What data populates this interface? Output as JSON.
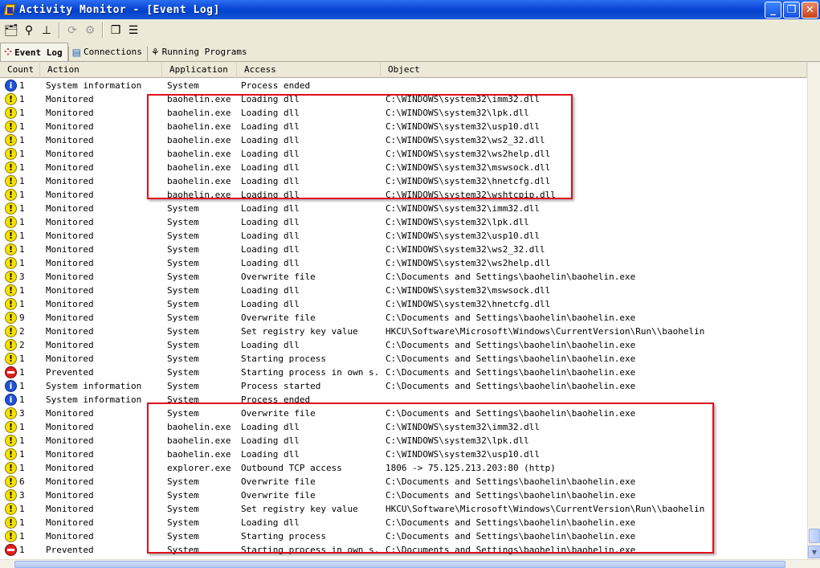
{
  "window": {
    "title": "Activity Monitor - [Event Log]",
    "icon": "activity-monitor-app-icon",
    "buttons": [
      "minimize",
      "maximize",
      "close"
    ]
  },
  "toolbar": {
    "icons": [
      "properties-icon",
      "find-icon",
      "filter-icon",
      "refresh-icon",
      "settings-icon",
      "cascade-icon",
      "tile-icon"
    ]
  },
  "tabs": [
    {
      "label": "Event Log",
      "icon": "event-log-icon",
      "active": true
    },
    {
      "label": "Connections",
      "icon": "connections-icon",
      "active": false
    },
    {
      "label": "Running Programs",
      "icon": "running-programs-icon",
      "active": false
    }
  ],
  "columns": [
    "Count",
    "Action",
    "Application",
    "Access",
    "Object"
  ],
  "rows": [
    {
      "type": "info",
      "count": "1",
      "action": "System information",
      "app": "System",
      "access": "Process ended",
      "object": ""
    },
    {
      "type": "warn",
      "count": "1",
      "action": "Monitored",
      "app": "baohelin.exe",
      "access": "Loading dll",
      "object": "C:\\WINDOWS\\system32\\imm32.dll"
    },
    {
      "type": "warn",
      "count": "1",
      "action": "Monitored",
      "app": "baohelin.exe",
      "access": "Loading dll",
      "object": "C:\\WINDOWS\\system32\\lpk.dll"
    },
    {
      "type": "warn",
      "count": "1",
      "action": "Monitored",
      "app": "baohelin.exe",
      "access": "Loading dll",
      "object": "C:\\WINDOWS\\system32\\usp10.dll"
    },
    {
      "type": "warn",
      "count": "1",
      "action": "Monitored",
      "app": "baohelin.exe",
      "access": "Loading dll",
      "object": "C:\\WINDOWS\\system32\\ws2_32.dll"
    },
    {
      "type": "warn",
      "count": "1",
      "action": "Monitored",
      "app": "baohelin.exe",
      "access": "Loading dll",
      "object": "C:\\WINDOWS\\system32\\ws2help.dll"
    },
    {
      "type": "warn",
      "count": "1",
      "action": "Monitored",
      "app": "baohelin.exe",
      "access": "Loading dll",
      "object": "C:\\WINDOWS\\system32\\mswsock.dll"
    },
    {
      "type": "warn",
      "count": "1",
      "action": "Monitored",
      "app": "baohelin.exe",
      "access": "Loading dll",
      "object": "C:\\WINDOWS\\system32\\hnetcfg.dll"
    },
    {
      "type": "warn",
      "count": "1",
      "action": "Monitored",
      "app": "baohelin.exe",
      "access": "Loading dll",
      "object": "C:\\WINDOWS\\system32\\wshtcpip.dll"
    },
    {
      "type": "warn",
      "count": "1",
      "action": "Monitored",
      "app": "System",
      "access": "Loading dll",
      "object": "C:\\WINDOWS\\system32\\imm32.dll"
    },
    {
      "type": "warn",
      "count": "1",
      "action": "Monitored",
      "app": "System",
      "access": "Loading dll",
      "object": "C:\\WINDOWS\\system32\\lpk.dll"
    },
    {
      "type": "warn",
      "count": "1",
      "action": "Monitored",
      "app": "System",
      "access": "Loading dll",
      "object": "C:\\WINDOWS\\system32\\usp10.dll"
    },
    {
      "type": "warn",
      "count": "1",
      "action": "Monitored",
      "app": "System",
      "access": "Loading dll",
      "object": "C:\\WINDOWS\\system32\\ws2_32.dll"
    },
    {
      "type": "warn",
      "count": "1",
      "action": "Monitored",
      "app": "System",
      "access": "Loading dll",
      "object": "C:\\WINDOWS\\system32\\ws2help.dll"
    },
    {
      "type": "warn",
      "count": "3",
      "action": "Monitored",
      "app": "System",
      "access": "Overwrite file",
      "object": "C:\\Documents and Settings\\baohelin\\baohelin.exe"
    },
    {
      "type": "warn",
      "count": "1",
      "action": "Monitored",
      "app": "System",
      "access": "Loading dll",
      "object": "C:\\WINDOWS\\system32\\mswsock.dll"
    },
    {
      "type": "warn",
      "count": "1",
      "action": "Monitored",
      "app": "System",
      "access": "Loading dll",
      "object": "C:\\WINDOWS\\system32\\hnetcfg.dll"
    },
    {
      "type": "warn",
      "count": "9",
      "action": "Monitored",
      "app": "System",
      "access": "Overwrite file",
      "object": "C:\\Documents and Settings\\baohelin\\baohelin.exe"
    },
    {
      "type": "warn",
      "count": "2",
      "action": "Monitored",
      "app": "System",
      "access": "Set registry key value",
      "object": "HKCU\\Software\\Microsoft\\Windows\\CurrentVersion\\Run\\\\baohelin"
    },
    {
      "type": "warn",
      "count": "2",
      "action": "Monitored",
      "app": "System",
      "access": "Loading dll",
      "object": "C:\\Documents and Settings\\baohelin\\baohelin.exe"
    },
    {
      "type": "warn",
      "count": "1",
      "action": "Monitored",
      "app": "System",
      "access": "Starting process",
      "object": "C:\\Documents and Settings\\baohelin\\baohelin.exe"
    },
    {
      "type": "stop",
      "count": "1",
      "action": "Prevented",
      "app": "System",
      "access": "Starting process in own s...",
      "object": "C:\\Documents and Settings\\baohelin\\baohelin.exe"
    },
    {
      "type": "info",
      "count": "1",
      "action": "System information",
      "app": "System",
      "access": "Process started",
      "object": "C:\\Documents and Settings\\baohelin\\baohelin.exe"
    },
    {
      "type": "info",
      "count": "1",
      "action": "System information",
      "app": "System",
      "access": "Process ended",
      "object": ""
    },
    {
      "type": "warn",
      "count": "3",
      "action": "Monitored",
      "app": "System",
      "access": "Overwrite file",
      "object": "C:\\Documents and Settings\\baohelin\\baohelin.exe"
    },
    {
      "type": "warn",
      "count": "1",
      "action": "Monitored",
      "app": "baohelin.exe",
      "access": "Loading dll",
      "object": "C:\\WINDOWS\\system32\\imm32.dll"
    },
    {
      "type": "warn",
      "count": "1",
      "action": "Monitored",
      "app": "baohelin.exe",
      "access": "Loading dll",
      "object": "C:\\WINDOWS\\system32\\lpk.dll"
    },
    {
      "type": "warn",
      "count": "1",
      "action": "Monitored",
      "app": "baohelin.exe",
      "access": "Loading dll",
      "object": "C:\\WINDOWS\\system32\\usp10.dll"
    },
    {
      "type": "warn",
      "count": "1",
      "action": "Monitored",
      "app": "explorer.exe",
      "access": "Outbound TCP access",
      "object": "1806 -> 75.125.213.203:80 (http)"
    },
    {
      "type": "warn",
      "count": "6",
      "action": "Monitored",
      "app": "System",
      "access": "Overwrite file",
      "object": "C:\\Documents and Settings\\baohelin\\baohelin.exe"
    },
    {
      "type": "warn",
      "count": "3",
      "action": "Monitored",
      "app": "System",
      "access": "Overwrite file",
      "object": "C:\\Documents and Settings\\baohelin\\baohelin.exe"
    },
    {
      "type": "warn",
      "count": "1",
      "action": "Monitored",
      "app": "System",
      "access": "Set registry key value",
      "object": "HKCU\\Software\\Microsoft\\Windows\\CurrentVersion\\Run\\\\baohelin"
    },
    {
      "type": "warn",
      "count": "1",
      "action": "Monitored",
      "app": "System",
      "access": "Loading dll",
      "object": "C:\\Documents and Settings\\baohelin\\baohelin.exe"
    },
    {
      "type": "warn",
      "count": "1",
      "action": "Monitored",
      "app": "System",
      "access": "Starting process",
      "object": "C:\\Documents and Settings\\baohelin\\baohelin.exe"
    },
    {
      "type": "stop",
      "count": "1",
      "action": "Prevented",
      "app": "System",
      "access": "Starting process in own s...",
      "object": "C:\\Documents and Settings\\baohelin\\baohelin.exe"
    }
  ],
  "highlight_color": "#e0101e"
}
